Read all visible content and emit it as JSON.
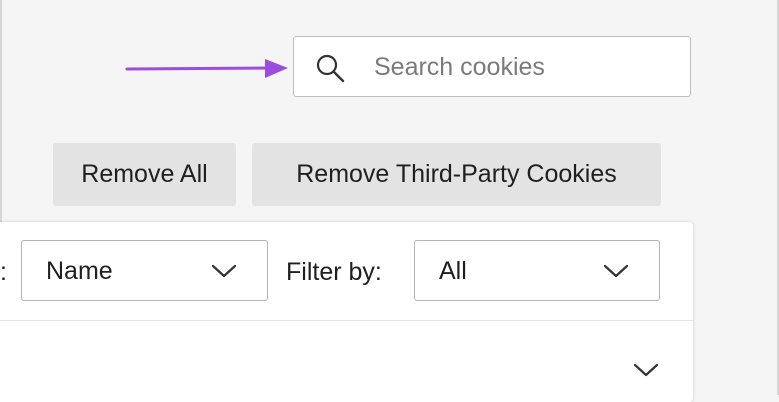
{
  "search": {
    "placeholder": "Search cookies",
    "value": "",
    "icon": "search-icon"
  },
  "annotation": {
    "icon": "arrow-right-icon",
    "color": "#9b4de0"
  },
  "actions": {
    "remove_all_label": "Remove All",
    "remove_third_party_label": "Remove Third-Party Cookies"
  },
  "toolbar": {
    "sort_label_fragment": ":",
    "sort_value": "Name",
    "filter_label": "Filter by:",
    "filter_value": "All",
    "dropdown_icon": "chevron-down-icon"
  },
  "list": {
    "row_expand_icon": "chevron-down-icon"
  }
}
